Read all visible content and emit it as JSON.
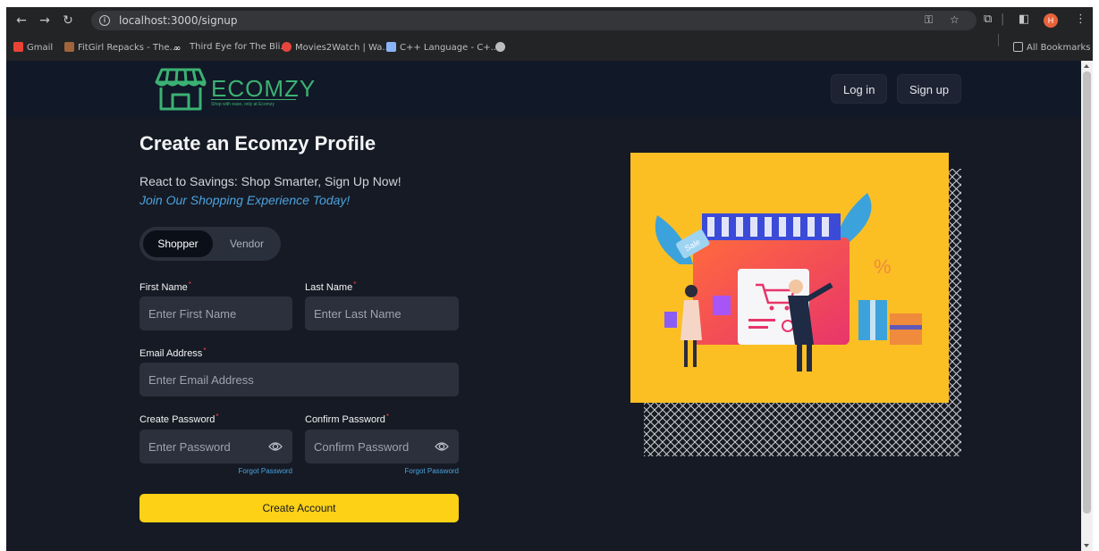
{
  "browser": {
    "url": "localhost:3000/signup",
    "profile_initial": "H",
    "bookmarks": [
      {
        "label": "Gmail",
        "color": "#ea4335"
      },
      {
        "label": "FitGirl Repacks - The...",
        "color": "#a0643c"
      },
      {
        "label": "Third Eye for The Bli...",
        "color": "#ffffff"
      },
      {
        "label": "Movies2Watch | Wa...",
        "color": "#e8453c"
      },
      {
        "label": "C++ Language - C+...",
        "color": "#8ab4f8"
      },
      {
        "label": "",
        "color": "#bdbdbd"
      }
    ],
    "all_bookmarks": "All Bookmarks"
  },
  "navbar": {
    "logo_text": "ECOMZY",
    "logo_tagline": "Shop with ease, only at Ecomzy",
    "login": "Log in",
    "signup": "Sign up"
  },
  "form": {
    "title": "Create an Ecomzy Profile",
    "subtitle": "React to Savings: Shop Smarter, Sign Up Now!",
    "tagline": "Join Our Shopping Experience Today!",
    "account_types": [
      "Shopper",
      "Vendor"
    ],
    "selected_account_type": "Shopper",
    "first_name": {
      "label": "First Name",
      "placeholder": "Enter First Name"
    },
    "last_name": {
      "label": "Last Name",
      "placeholder": "Enter Last Name"
    },
    "email": {
      "label": "Email Address",
      "placeholder": "Enter Email Address"
    },
    "password": {
      "label": "Create Password",
      "placeholder": "Enter Password",
      "forgot": "Forgot Password"
    },
    "confirm_password": {
      "label": "Confirm Password",
      "placeholder": "Confirm Password",
      "forgot": "Forgot Password"
    },
    "required_mark": "*",
    "submit": "Create Account"
  },
  "hero": {
    "badge_text": "Sale",
    "percent_text": "%"
  },
  "colors": {
    "accent_yellow": "#fcd116",
    "brand_green": "#3bb273",
    "link_blue": "#4aa3df",
    "background": "#161a24"
  }
}
